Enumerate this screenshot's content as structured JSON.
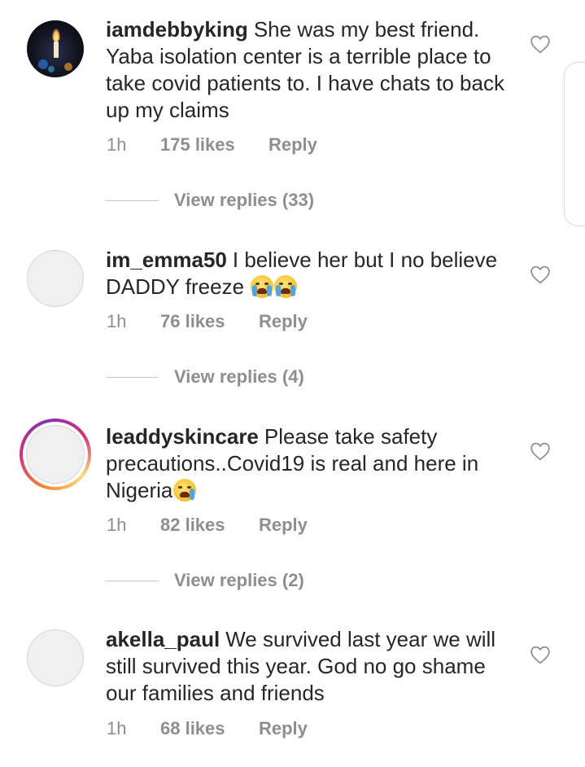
{
  "comments": [
    {
      "username": "iamdebbyking",
      "text": "She was my best friend. Yaba isolation center is a terrible place to take covid patients to. I have chats to back up my claims",
      "time": "1h",
      "likes": "175 likes",
      "reply": "Reply",
      "view_replies": "View replies (33)",
      "avatar": "candle-photo-avatar"
    },
    {
      "username": "im_emma50",
      "text": "I believe her but I no believe DADDY freeze ",
      "emojis": [
        "loudly-crying-face",
        "loudly-crying-face"
      ],
      "time": "1h",
      "likes": "76 likes",
      "reply": "Reply",
      "view_replies": "View replies (4)",
      "avatar": "default-avatar"
    },
    {
      "username": "leaddyskincare",
      "text": "Please take safety precautions..Covid19 is real and here in Nigeria",
      "emojis": [
        "crying-face"
      ],
      "time": "1h",
      "likes": "82 likes",
      "reply": "Reply",
      "view_replies": "View replies (2)",
      "avatar": "story-ring-avatar"
    },
    {
      "username": "akella_paul",
      "text": "We survived last year we will still survived this year. God no go shame our families and friends",
      "time": "1h",
      "likes": "68 likes",
      "reply": "Reply",
      "avatar": "default-avatar"
    }
  ],
  "icons": {
    "like": "heart-outline-icon"
  },
  "colors": {
    "text": "#262626",
    "secondary": "#8e8e8e",
    "divider": "#c7c7c7",
    "story_ring_start": "#f58529",
    "story_ring_end": "#dd2a7b"
  }
}
